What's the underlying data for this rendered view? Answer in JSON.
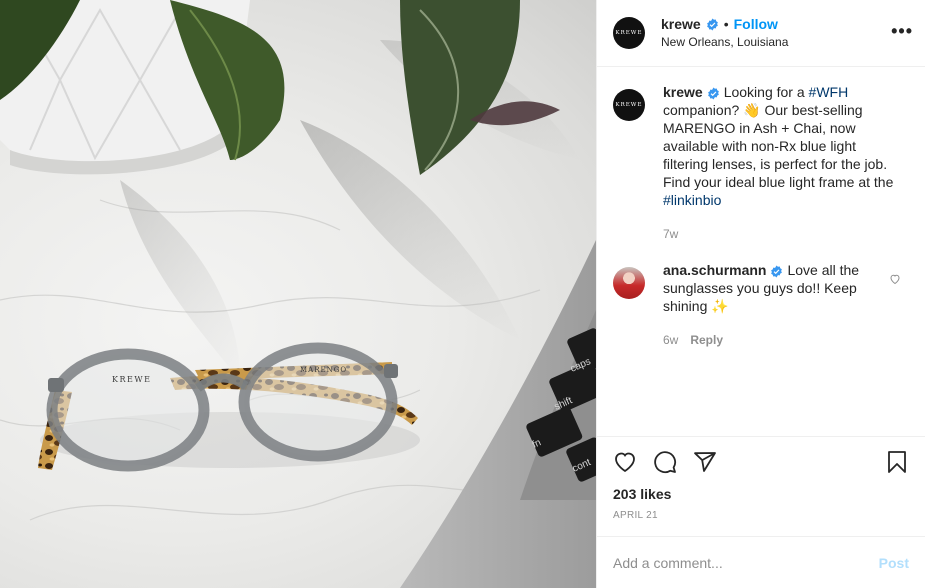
{
  "photo": {
    "frame_brand": "KREWE",
    "frame_model": "MARENGO"
  },
  "header": {
    "avatar_text": "KREWE",
    "username": "krewe",
    "dot": "•",
    "follow_label": "Follow",
    "location": "New Orleans, Louisiana",
    "more_label": "•••"
  },
  "caption": {
    "avatar_text": "KREWE",
    "username": "krewe",
    "text_1": "Looking for a ",
    "hashtag_1": "#WFH",
    "text_2": " companion? 👋 Our best-selling MARENGO in Ash + Chai, now available with non-Rx blue light filtering lenses, is perfect for the job. Find your ideal blue light frame at the ",
    "hashtag_2": "#linkinbio",
    "age": "7w"
  },
  "comment": {
    "username": "ana.schurmann",
    "text": "Love all the sunglasses you guys do!! Keep shining ✨",
    "age": "6w",
    "reply_label": "Reply"
  },
  "stats": {
    "likes": "203 likes",
    "date": "APRIL 21"
  },
  "add_comment": {
    "placeholder": "Add a comment...",
    "post_label": "Post"
  },
  "colors": {
    "link_blue": "#0095f6",
    "hashtag": "#00376b",
    "muted": "#8e8e8e",
    "post_disabled": "#b2dffc"
  }
}
